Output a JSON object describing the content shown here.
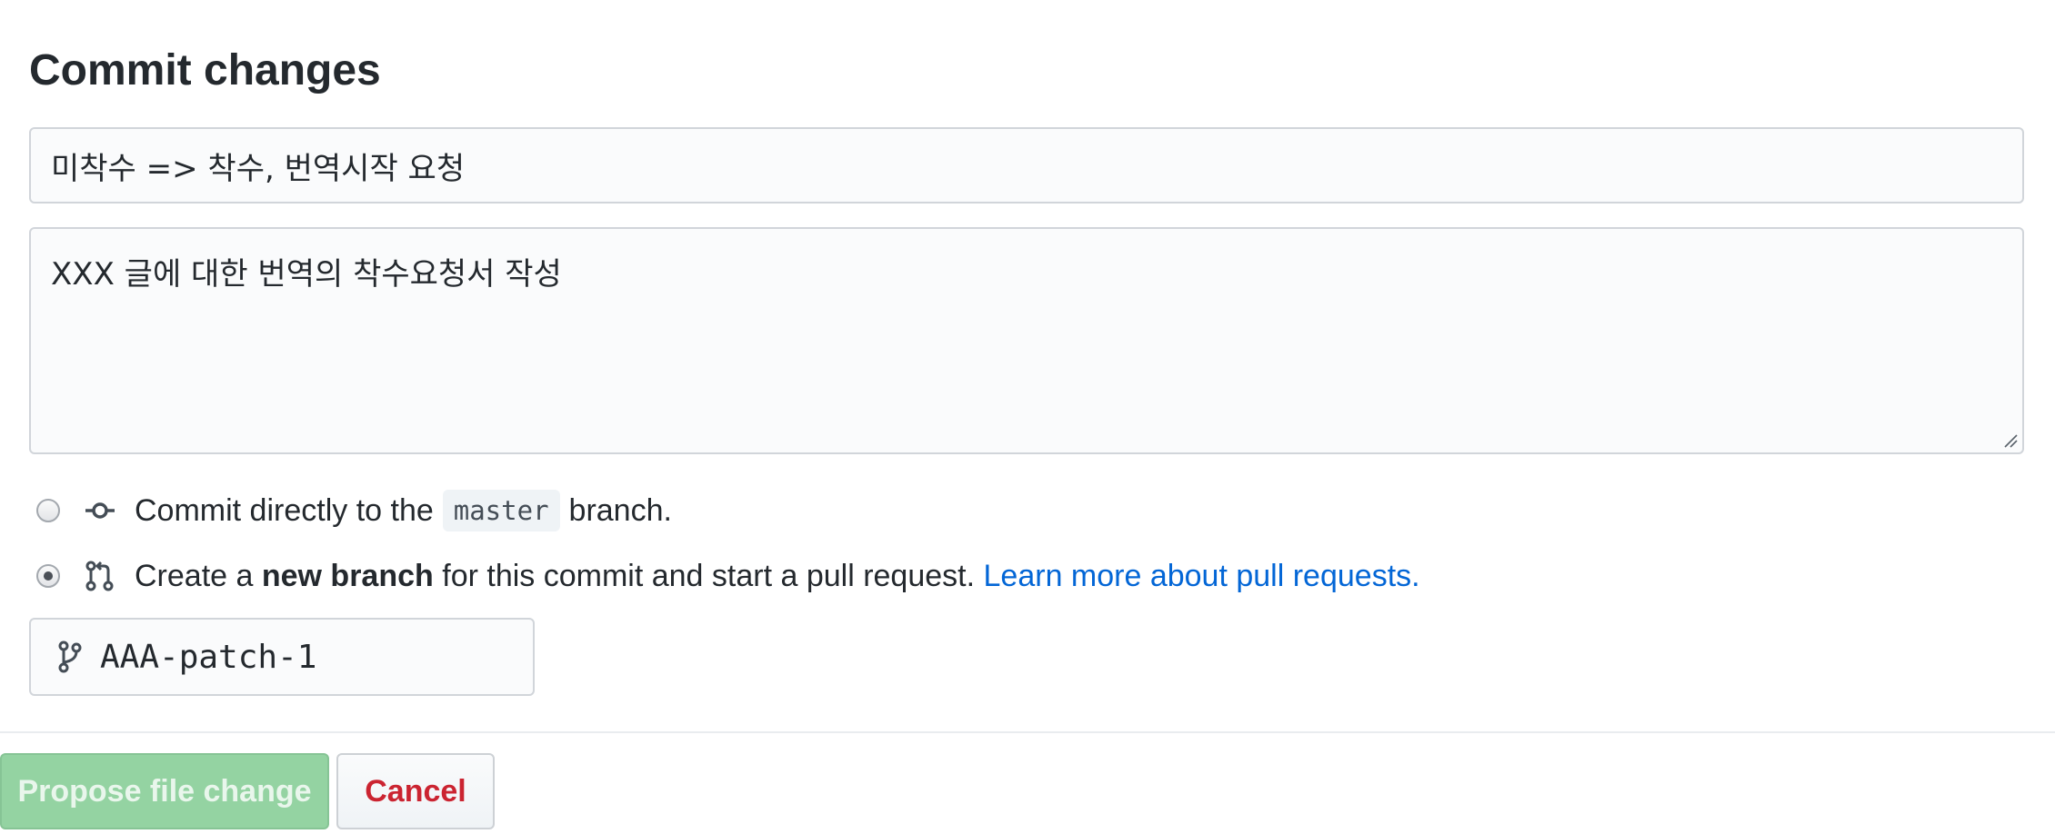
{
  "header": {
    "title": "Commit changes"
  },
  "commit": {
    "summary_value": "미착수 => 착수, 번역시작 요청",
    "description_value": "XXX 글에 대한 번역의 착수요청서 작성"
  },
  "options": {
    "direct": {
      "prefix": "Commit directly to the",
      "branch": "master",
      "suffix": "branch.",
      "checked": false
    },
    "new_branch": {
      "prefix": "Create a",
      "bold": "new branch",
      "middle": "for this commit and start a pull request.",
      "link": "Learn more about pull requests.",
      "checked": true
    }
  },
  "branch_name": {
    "value": "AAA-patch-1"
  },
  "buttons": {
    "propose": "Propose file change",
    "cancel": "Cancel"
  },
  "colors": {
    "link": "#0366d6",
    "propose_bg": "#94d3a2",
    "cancel_text": "#cb2431"
  },
  "icons": {
    "direct": "git-commit-icon",
    "new_branch": "git-pull-request-icon",
    "branch_field": "git-branch-icon"
  }
}
